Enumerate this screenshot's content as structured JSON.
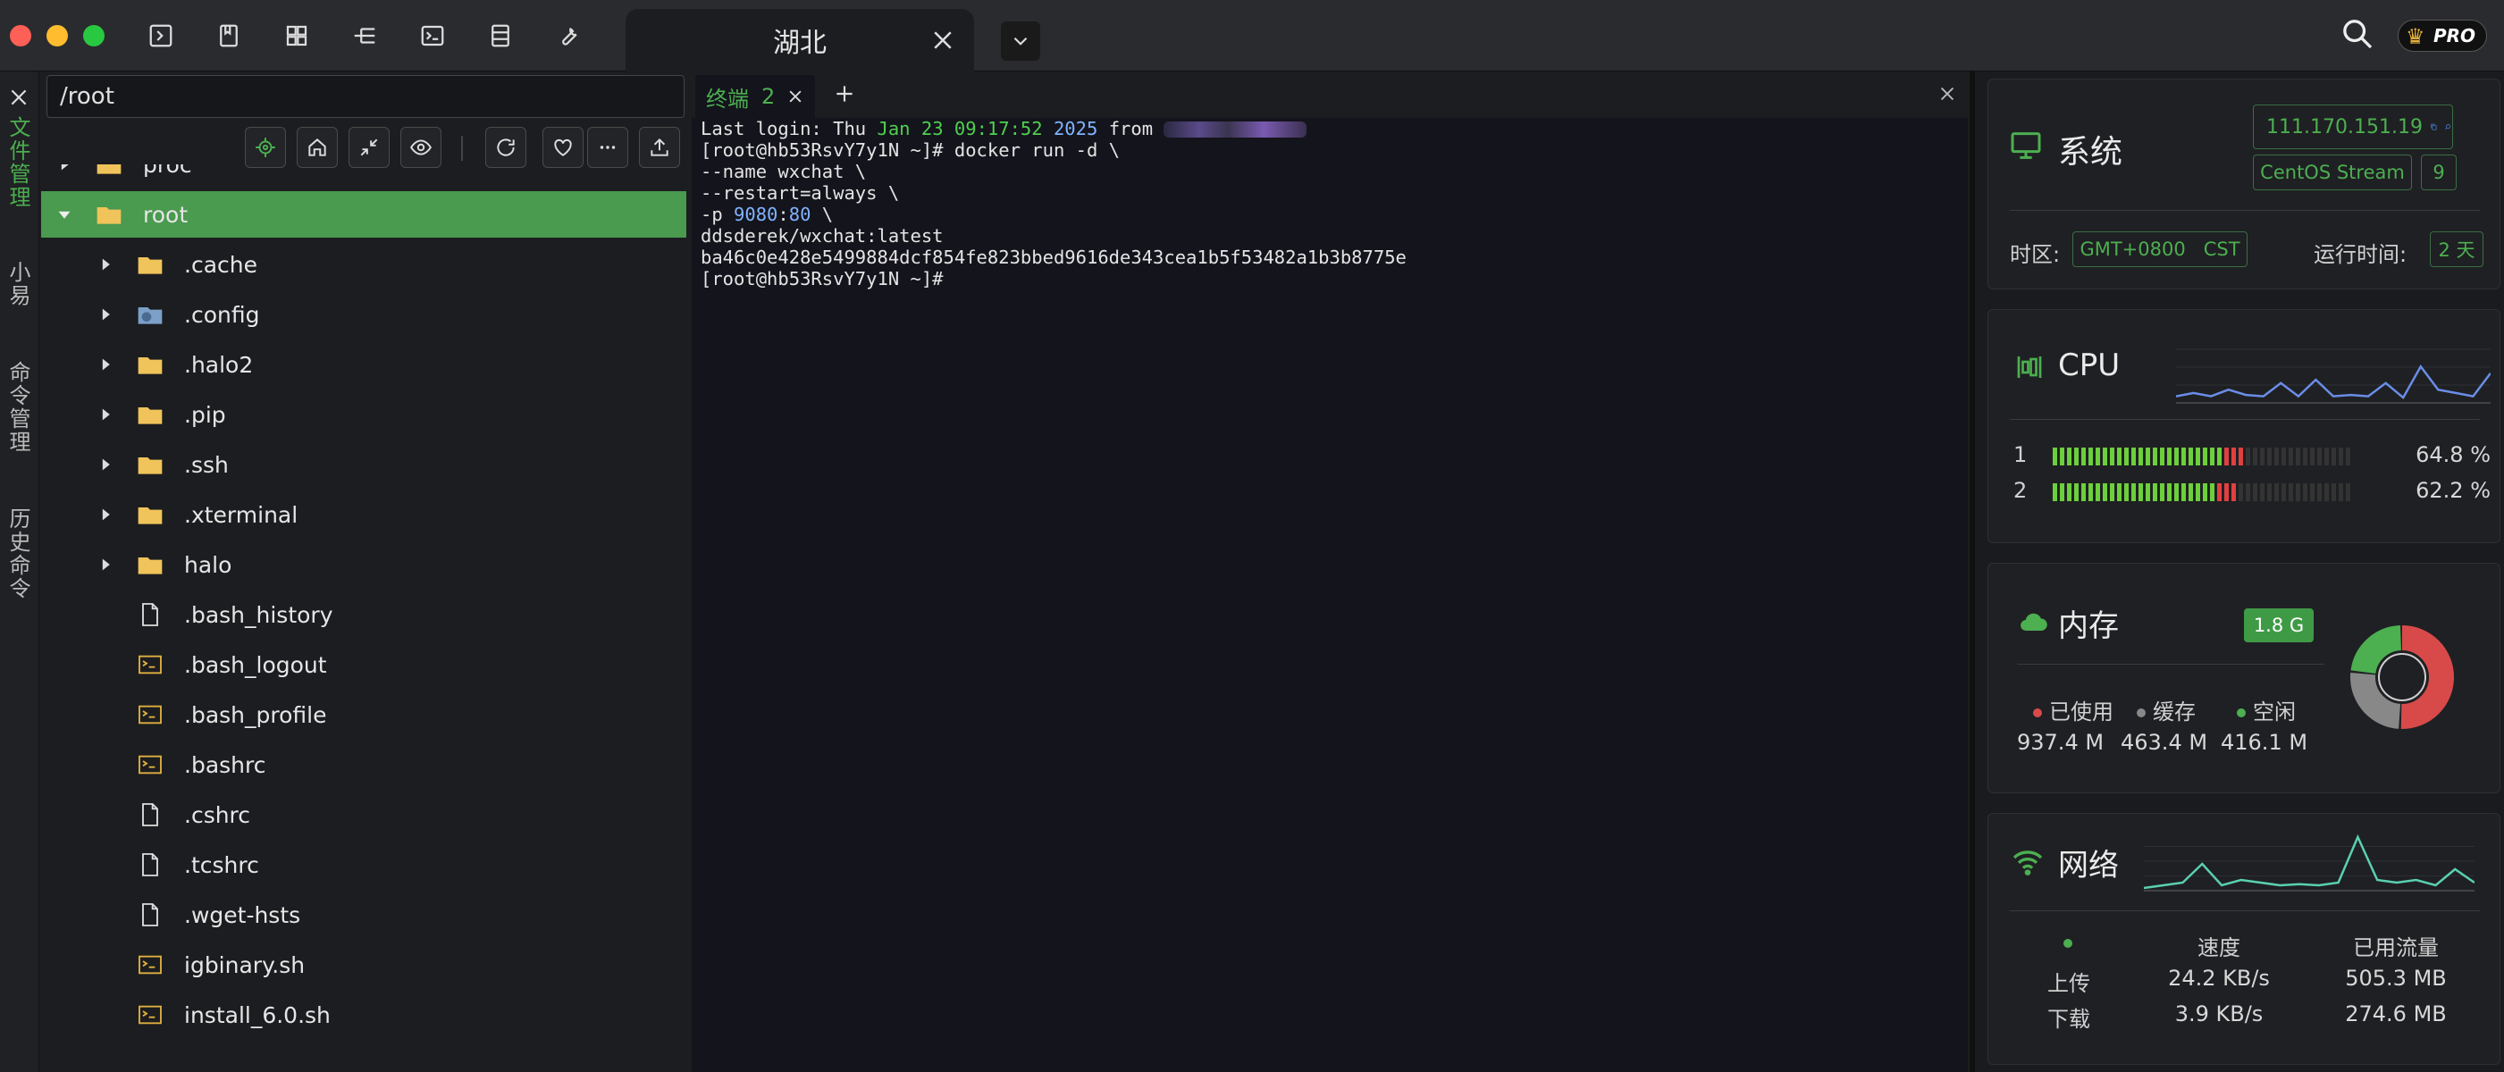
{
  "titlebar": {
    "tab_title": "湖北",
    "pro_label": "PRO"
  },
  "siderail": {
    "items": [
      "文件管理",
      "小易",
      "命令管理",
      "历史命令"
    ]
  },
  "file_manager": {
    "path": "/root",
    "entries": [
      {
        "name": "proc",
        "type": "folder",
        "expandable": true,
        "level": 0
      },
      {
        "name": "root",
        "type": "folder",
        "expandable": true,
        "expanded": true,
        "level": 0,
        "selected": true
      },
      {
        "name": ".cache",
        "type": "folder",
        "expandable": true,
        "level": 1
      },
      {
        "name": ".config",
        "type": "config-folder",
        "expandable": true,
        "level": 1
      },
      {
        "name": ".halo2",
        "type": "folder",
        "expandable": true,
        "level": 1
      },
      {
        "name": ".pip",
        "type": "folder",
        "expandable": true,
        "level": 1
      },
      {
        "name": ".ssh",
        "type": "folder",
        "expandable": true,
        "level": 1
      },
      {
        "name": ".xterminal",
        "type": "folder",
        "expandable": true,
        "level": 1
      },
      {
        "name": "halo",
        "type": "folder",
        "expandable": true,
        "level": 1
      },
      {
        "name": ".bash_history",
        "type": "file",
        "level": 1
      },
      {
        "name": ".bash_logout",
        "type": "script",
        "level": 1
      },
      {
        "name": ".bash_profile",
        "type": "script",
        "level": 1
      },
      {
        "name": ".bashrc",
        "type": "script",
        "level": 1
      },
      {
        "name": ".cshrc",
        "type": "file",
        "level": 1
      },
      {
        "name": ".tcshrc",
        "type": "file",
        "level": 1
      },
      {
        "name": ".wget-hsts",
        "type": "file",
        "level": 1
      },
      {
        "name": "igbinary.sh",
        "type": "script",
        "level": 1
      },
      {
        "name": "install_6.0.sh",
        "type": "script",
        "level": 1
      }
    ]
  },
  "terminal": {
    "tab_label": "终端",
    "tab_count": "2",
    "lines": [
      {
        "segments": [
          {
            "t": "Last login: Thu "
          },
          {
            "t": "Jan 23 09:17:52 ",
            "c": "green"
          },
          {
            "t": "2025 ",
            "c": "blue"
          },
          {
            "t": "from "
          }
        ],
        "redacted": true
      },
      {
        "segments": [
          {
            "t": "[root@hb53RsvY7y1N ~]# docker run -d \\"
          }
        ]
      },
      {
        "segments": [
          {
            "t": "--name wxchat \\"
          }
        ]
      },
      {
        "segments": [
          {
            "t": "--restart=always \\"
          }
        ]
      },
      {
        "segments": [
          {
            "t": "-p "
          },
          {
            "t": "9080",
            "c": "blue"
          },
          {
            "t": ":"
          },
          {
            "t": "80",
            "c": "blue"
          },
          {
            "t": " \\"
          }
        ]
      },
      {
        "segments": [
          {
            "t": "ddsderek/wxchat:latest"
          }
        ]
      },
      {
        "segments": [
          {
            "t": "ba46c0e428e5499884dcf854fe823bbed9616de343cea1b5f53482a1b3b8775e"
          }
        ]
      },
      {
        "segments": [
          {
            "t": "[root@hb53RsvY7y1N ~]# "
          }
        ]
      }
    ]
  },
  "system": {
    "title": "系统",
    "ip": "111.170.151.19",
    "os": "CentOS Stream",
    "os_version": "9",
    "timezone_label": "时区:",
    "timezone": "GMT+0800   CST",
    "uptime_label": "运行时间:",
    "uptime": "2 天"
  },
  "cpu": {
    "title": "CPU",
    "cores": [
      {
        "id": "1",
        "usage": "64.8 %",
        "fraction": 0.648
      },
      {
        "id": "2",
        "usage": "62.2 %",
        "fraction": 0.622
      }
    ],
    "history": [
      0.1,
      0.15,
      0.1,
      0.2,
      0.12,
      0.1,
      0.3,
      0.1,
      0.35,
      0.1,
      0.12,
      0.1,
      0.3,
      0.08,
      0.55,
      0.2,
      0.15,
      0.1,
      0.45
    ]
  },
  "memory": {
    "title": "内存",
    "total": "1.8 G",
    "legend": [
      {
        "label": "已使用",
        "value": "937.4 M",
        "color": "#d84a4a",
        "fraction": 0.51
      },
      {
        "label": "缓存",
        "value": "463.4 M",
        "color": "#888888",
        "fraction": 0.26
      },
      {
        "label": "空闲",
        "value": "416.1 M",
        "color": "#4caf50",
        "fraction": 0.23
      }
    ]
  },
  "network": {
    "title": "网络",
    "col_speed": "速度",
    "col_traffic": "已用流量",
    "upload_label": "上传",
    "download_label": "下载",
    "upload_speed": "24.2 KB/s",
    "upload_traffic": "505.3 MB",
    "download_speed": "3.9 KB/s",
    "download_traffic": "274.6 MB",
    "history": [
      0.05,
      0.1,
      0.15,
      0.5,
      0.1,
      0.2,
      0.15,
      0.1,
      0.12,
      0.1,
      0.15,
      1.0,
      0.2,
      0.15,
      0.2,
      0.1,
      0.4,
      0.15
    ]
  },
  "colors": {
    "accent": "#4caf50",
    "selected_row": "#4a9a4f",
    "folder": "#f0c45a",
    "cpu_ok": "#6ccf3c",
    "cpu_hot": "#e04040",
    "chart_line_cpu": "#6a8de8",
    "chart_line_net": "#5ad0b0"
  }
}
